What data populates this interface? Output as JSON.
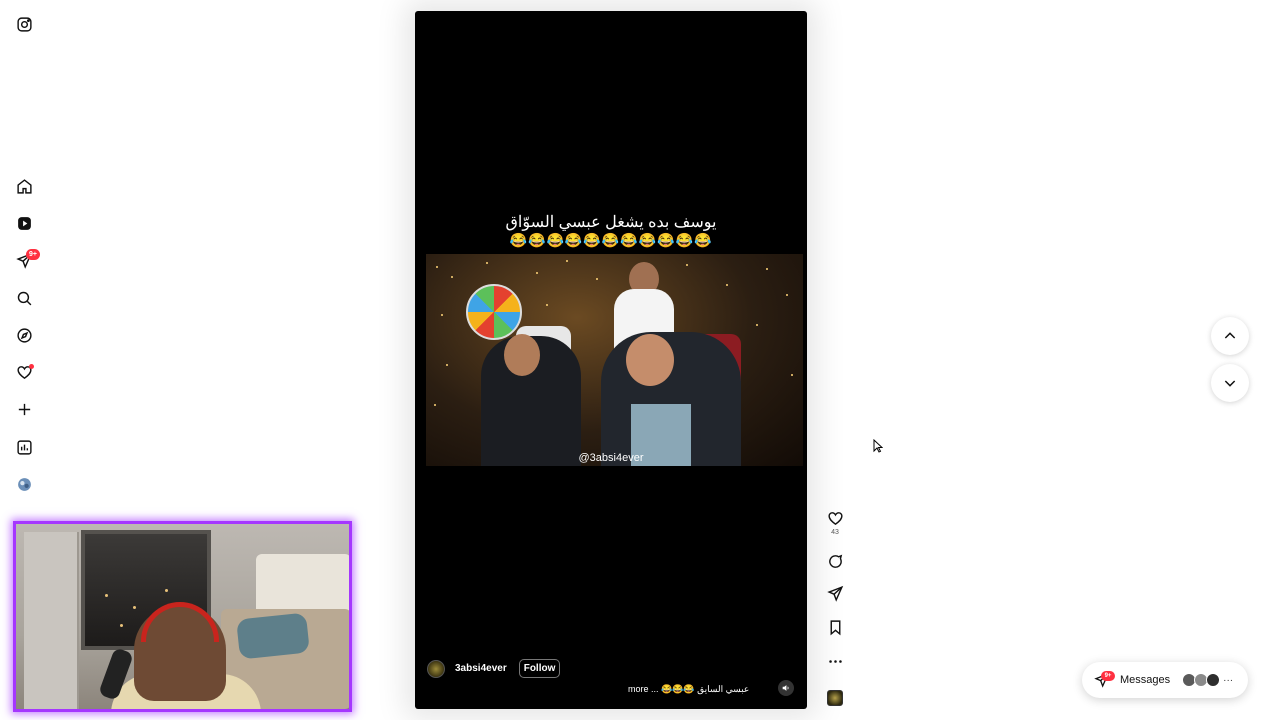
{
  "sidebar": {
    "items": [
      {
        "name": "instagram-logo"
      },
      {
        "name": "home"
      },
      {
        "name": "reels"
      },
      {
        "name": "messages",
        "badge": "9+"
      },
      {
        "name": "search"
      },
      {
        "name": "explore"
      },
      {
        "name": "notifications"
      },
      {
        "name": "create"
      },
      {
        "name": "dashboard"
      },
      {
        "name": "profile"
      }
    ]
  },
  "reel": {
    "overlay_title": "يوسف بده يشغل عبسي السوّاق",
    "overlay_emojis": "😂😂😂😂😂😂😂😂😂😂😂",
    "watermark": "@3absi4ever",
    "author": "3absi4ever",
    "follow_label": "Follow",
    "caption": "عبسي السايق 😂😂😂 ... more"
  },
  "actions": {
    "like_count": "43"
  },
  "messages_pill": {
    "label": "Messages",
    "badge": "9+",
    "more": "···"
  },
  "colors": {
    "accent_red": "#ff3040",
    "webcam_border": "#a536ff"
  }
}
